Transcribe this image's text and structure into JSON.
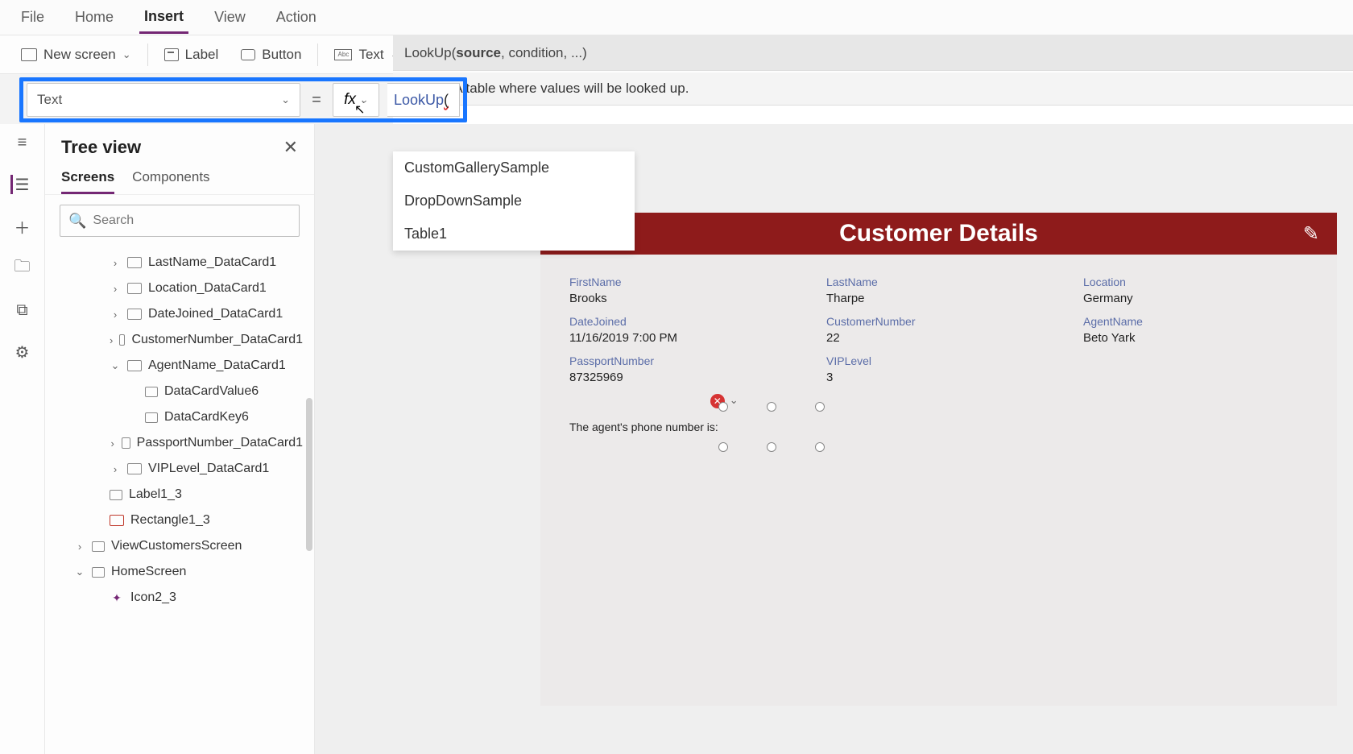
{
  "menu": {
    "file": "File",
    "home": "Home",
    "insert": "Insert",
    "view": "View",
    "action": "Action"
  },
  "ribbon": {
    "newscreen": "New screen",
    "label": "Label",
    "button": "Button",
    "text": "Text"
  },
  "formula": {
    "property": "Text",
    "fx": "fx",
    "expr_fn": "LookUp",
    "expr_rest": "(",
    "signature_pre": "LookUp(",
    "signature_bold": "source",
    "signature_post": ", condition, ...)",
    "param_name": "source:",
    "param_desc": " A table where values will be looked up."
  },
  "suggestions": [
    "CustomGallerySample",
    "DropDownSample",
    "Table1"
  ],
  "tree": {
    "title": "Tree view",
    "tabs": {
      "screens": "Screens",
      "components": "Components"
    },
    "search_ph": "Search",
    "nodes": [
      {
        "depth": 2,
        "exp": ">",
        "icon": "card",
        "label": "LastName_DataCard1"
      },
      {
        "depth": 2,
        "exp": ">",
        "icon": "card",
        "label": "Location_DataCard1"
      },
      {
        "depth": 2,
        "exp": ">",
        "icon": "card",
        "label": "DateJoined_DataCard1"
      },
      {
        "depth": 2,
        "exp": ">",
        "icon": "card",
        "label": "CustomerNumber_DataCard1"
      },
      {
        "depth": 2,
        "exp": "v",
        "icon": "card",
        "label": "AgentName_DataCard1"
      },
      {
        "depth": 3,
        "exp": "",
        "icon": "label",
        "label": "DataCardValue6"
      },
      {
        "depth": 3,
        "exp": "",
        "icon": "label",
        "label": "DataCardKey6"
      },
      {
        "depth": 2,
        "exp": ">",
        "icon": "card",
        "label": "PassportNumber_DataCard1"
      },
      {
        "depth": 2,
        "exp": ">",
        "icon": "card",
        "label": "VIPLevel_DataCard1"
      },
      {
        "depth": 1,
        "exp": "",
        "icon": "label",
        "label": "Label1_3"
      },
      {
        "depth": 1,
        "exp": "",
        "icon": "rect",
        "label": "Rectangle1_3"
      },
      {
        "depth": 0,
        "exp": ">",
        "icon": "screen",
        "label": "ViewCustomersScreen"
      },
      {
        "depth": 0,
        "exp": "v",
        "icon": "screen",
        "label": "HomeScreen"
      },
      {
        "depth": 1,
        "exp": "",
        "icon": "icongrp",
        "label": "Icon2_3"
      }
    ]
  },
  "canvas": {
    "title": "Customer Details",
    "fields": [
      {
        "lab": "FirstName",
        "val": "Brooks"
      },
      {
        "lab": "LastName",
        "val": "Tharpe"
      },
      {
        "lab": "Location",
        "val": "Germany"
      },
      {
        "lab": "DateJoined",
        "val": "11/16/2019 7:00 PM"
      },
      {
        "lab": "CustomerNumber",
        "val": "22"
      },
      {
        "lab": "AgentName",
        "val": "Beto Yark"
      },
      {
        "lab": "PassportNumber",
        "val": "87325969"
      },
      {
        "lab": "VIPLevel",
        "val": "3"
      }
    ],
    "agent_line": "The agent's phone number is:"
  }
}
